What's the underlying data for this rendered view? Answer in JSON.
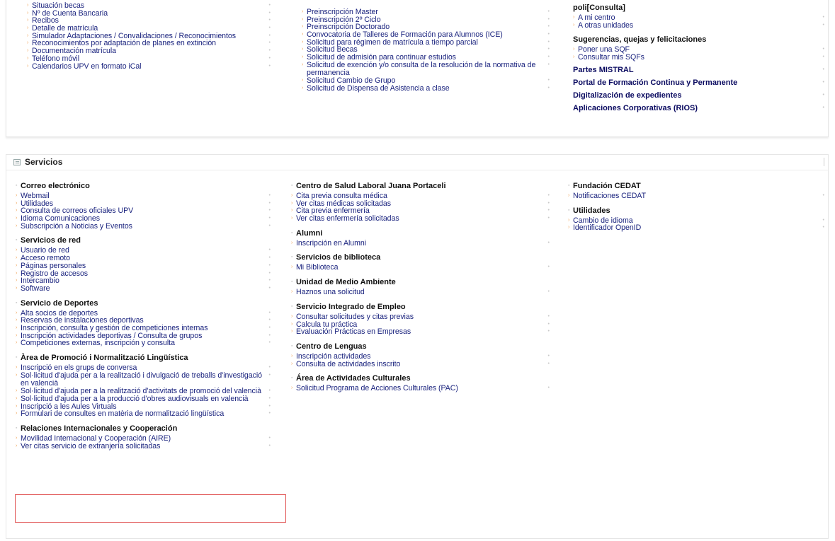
{
  "top": {
    "col1": [
      {
        "label": "Situación becas"
      },
      {
        "label": "Nº de Cuenta Bancaria"
      },
      {
        "label": "Recibos"
      },
      {
        "label": "Detalle de matrícula"
      },
      {
        "label": "Simulador Adaptaciones / Convalidaciones / Reconocimientos"
      },
      {
        "label": "Reconocimientos por adaptación de planes en extinción"
      },
      {
        "label": "Documentación matrícula"
      },
      {
        "label": "Teléfono móvil"
      },
      {
        "label": "Calendarios UPV en formato iCal"
      }
    ],
    "col2": [
      {
        "label": "Preinscripción Master"
      },
      {
        "label": "Preinscripción 2º Ciclo"
      },
      {
        "label": "Preinscripción Doctorado"
      },
      {
        "label": "Convocatoria de Talleres de Formación para Alumnos (ICE)"
      },
      {
        "label": "Solicitud para régimen de matrícula a tiempo parcial"
      },
      {
        "label": "Solicitud Becas"
      },
      {
        "label": "Solicitud de admisión para continuar estudios"
      },
      {
        "label": "Solicitud de exención y/o consulta de la resolución de la normativa de permanencia",
        "wrap": true
      },
      {
        "label": "Solicitud Cambio de Grupo"
      },
      {
        "label": "Solicitud de Dispensa de Asistencia a clase"
      }
    ],
    "col3": {
      "consulta_title": "poli[Consulta]",
      "consulta_items": [
        "A mi centro",
        "A otras unidades"
      ],
      "sqf_title": "Sugerencias, quejas y felicitaciones",
      "sqf_items": [
        "Poner una SQF",
        "Consultar mis SQFs"
      ],
      "bold_links": [
        "Partes MISTRAL",
        "Portal de Formación Continua y Permanente",
        "Digitalización de expedientes",
        "Aplicaciones Corporativas (RIOS)"
      ]
    }
  },
  "servicios": {
    "title": "Servicios",
    "col1": [
      {
        "title": "Correo electrónico",
        "items": [
          "Webmail",
          "Utilidades",
          "Consulta de correos oficiales UPV",
          "Idioma Comunicaciones",
          "Subscripción a Noticias y Eventos"
        ]
      },
      {
        "title": "Servicios de red",
        "items": [
          "Usuario de red",
          "Acceso remoto",
          "Páginas personales",
          "Registro de accesos",
          "Intercambio",
          "Software"
        ]
      },
      {
        "title": "Servicio de Deportes",
        "items": [
          "Alta socios de deportes",
          "Reservas de instalaciones deportivas",
          "Inscripción, consulta y gestión de competiciones internas",
          "Inscripción actividades deportivas / Consulta de grupos",
          "Competiciones externas, inscripción y consulta"
        ]
      },
      {
        "title": "Àrea de Promoció i Normalització Lingüística",
        "items": [
          "Inscripció en els grups de conversa",
          "Sol·licitud d'ajuda per a la realització i divulgació de treballs d'investigació en valencià",
          "Sol·licitud d'ajuda per a la realització d'activitats de promoció del valencià",
          "Sol·licitud d'ajuda per a la producció d'obres audiovisuals en valencià",
          "Inscripció a les Aules Virtuals",
          "Formulari de consultes en matèria de normalització lingüística"
        ]
      },
      {
        "title": "Relaciones Internacionales y Cooperación",
        "items": [
          "Movilidad Internacional y Cooperación (AIRE)",
          "Ver citas servicio de extranjería solicitadas"
        ]
      }
    ],
    "col2": [
      {
        "title": "Centro de Salud Laboral Juana Portaceli",
        "items": [
          "Cita previa consulta médica",
          "Ver citas médicas solicitadas",
          "Cita previa enfermería",
          "Ver citas enfermería solicitadas"
        ]
      },
      {
        "title": "Alumni",
        "items": [
          "Inscripción en Alumni"
        ]
      },
      {
        "title": "Servicios de biblioteca",
        "items": [
          "Mi Biblioteca"
        ]
      },
      {
        "title": "Unidad de Medio Ambiente",
        "items": [
          "Haznos una solicitud"
        ]
      },
      {
        "title": "Servicio Integrado de Empleo",
        "items": [
          "Consultar solicitudes y citas previas",
          "Calcula tu práctica",
          "Evaluación Prácticas en Empresas"
        ]
      },
      {
        "title": "Centro de Lenguas",
        "items": [
          "Inscripción actividades",
          "Consulta de actividades inscrito"
        ]
      },
      {
        "title": "Área de Actividades Culturales",
        "items": [
          "Solicitud Programa de Acciones Culturales (PAC)"
        ]
      }
    ],
    "col3": [
      {
        "title": "Fundación CEDAT",
        "items": [
          "Notificaciones CEDAT"
        ]
      },
      {
        "title": "Utilidades",
        "items": [
          "Cambio de idioma",
          "Identificador OpenID"
        ]
      }
    ]
  }
}
